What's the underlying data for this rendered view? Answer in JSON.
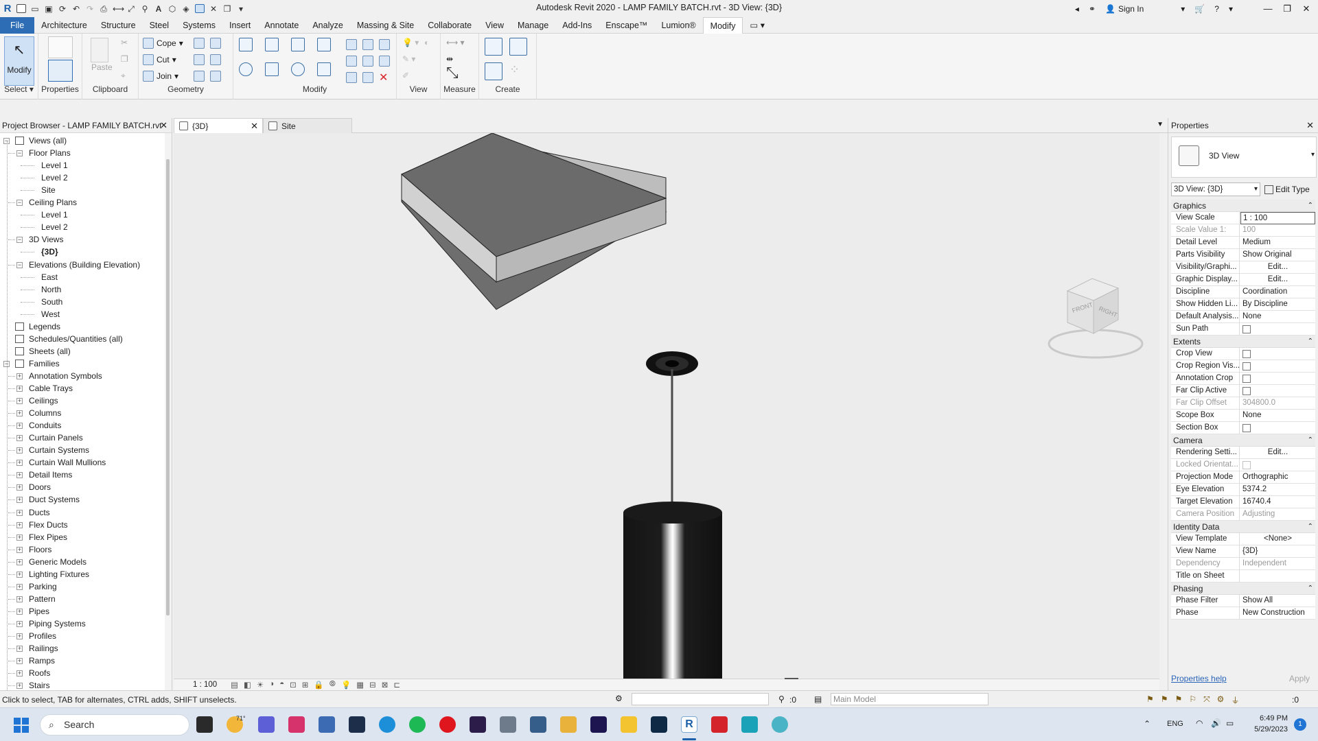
{
  "window": {
    "title": "Autodesk Revit 2020 - LAMP FAMILY BATCH.rvt - 3D View: {3D}",
    "sign_in": "Sign In"
  },
  "menu": [
    "File",
    "Architecture",
    "Structure",
    "Steel",
    "Systems",
    "Insert",
    "Annotate",
    "Analyze",
    "Massing & Site",
    "Collaborate",
    "View",
    "Manage",
    "Add-Ins",
    "Enscape™",
    "Lumion®",
    "Modify"
  ],
  "ribbon": {
    "select": {
      "modify": "Modify",
      "label": "Select"
    },
    "properties": {
      "label": "Properties",
      "btn": "Properties"
    },
    "clipboard": {
      "paste": "Paste",
      "label": "Clipboard"
    },
    "geometry": {
      "cope": "Cope",
      "cut": "Cut",
      "join": "Join",
      "label": "Geometry"
    },
    "modify": {
      "label": "Modify"
    },
    "view": {
      "label": "View"
    },
    "measure": {
      "label": "Measure"
    },
    "create": {
      "label": "Create"
    }
  },
  "browser": {
    "title": "Project Browser - LAMP FAMILY BATCH.rvt",
    "nodes": [
      {
        "text": "Views (all)",
        "level": 0,
        "exp": "-"
      },
      {
        "text": "Floor Plans",
        "level": 1,
        "exp": "-"
      },
      {
        "text": "Level 1",
        "level": 2
      },
      {
        "text": "Level 2",
        "level": 2
      },
      {
        "text": "Site",
        "level": 2
      },
      {
        "text": "Ceiling Plans",
        "level": 1,
        "exp": "-"
      },
      {
        "text": "Level 1",
        "level": 2
      },
      {
        "text": "Level 2",
        "level": 2
      },
      {
        "text": "3D Views",
        "level": 1,
        "exp": "-"
      },
      {
        "text": "{3D}",
        "level": 2,
        "bold": true
      },
      {
        "text": "Elevations (Building Elevation)",
        "level": 1,
        "exp": "-"
      },
      {
        "text": "East",
        "level": 2
      },
      {
        "text": "North",
        "level": 2
      },
      {
        "text": "South",
        "level": 2
      },
      {
        "text": "West",
        "level": 2
      },
      {
        "text": "Legends",
        "level": 0
      },
      {
        "text": "Schedules/Quantities (all)",
        "level": 0
      },
      {
        "text": "Sheets (all)",
        "level": 0
      },
      {
        "text": "Families",
        "level": 0,
        "exp": "-"
      },
      {
        "text": "Annotation Symbols",
        "level": 1,
        "exp": "+"
      },
      {
        "text": "Cable Trays",
        "level": 1,
        "exp": "+"
      },
      {
        "text": "Ceilings",
        "level": 1,
        "exp": "+"
      },
      {
        "text": "Columns",
        "level": 1,
        "exp": "+"
      },
      {
        "text": "Conduits",
        "level": 1,
        "exp": "+"
      },
      {
        "text": "Curtain Panels",
        "level": 1,
        "exp": "+"
      },
      {
        "text": "Curtain Systems",
        "level": 1,
        "exp": "+"
      },
      {
        "text": "Curtain Wall Mullions",
        "level": 1,
        "exp": "+"
      },
      {
        "text": "Detail Items",
        "level": 1,
        "exp": "+"
      },
      {
        "text": "Doors",
        "level": 1,
        "exp": "+"
      },
      {
        "text": "Duct Systems",
        "level": 1,
        "exp": "+"
      },
      {
        "text": "Ducts",
        "level": 1,
        "exp": "+"
      },
      {
        "text": "Flex Ducts",
        "level": 1,
        "exp": "+"
      },
      {
        "text": "Flex Pipes",
        "level": 1,
        "exp": "+"
      },
      {
        "text": "Floors",
        "level": 1,
        "exp": "+"
      },
      {
        "text": "Generic Models",
        "level": 1,
        "exp": "+"
      },
      {
        "text": "Lighting Fixtures",
        "level": 1,
        "exp": "+"
      },
      {
        "text": "Parking",
        "level": 1,
        "exp": "+"
      },
      {
        "text": "Pattern",
        "level": 1,
        "exp": "+"
      },
      {
        "text": "Pipes",
        "level": 1,
        "exp": "+"
      },
      {
        "text": "Piping Systems",
        "level": 1,
        "exp": "+"
      },
      {
        "text": "Profiles",
        "level": 1,
        "exp": "+"
      },
      {
        "text": "Railings",
        "level": 1,
        "exp": "+"
      },
      {
        "text": "Ramps",
        "level": 1,
        "exp": "+"
      },
      {
        "text": "Roofs",
        "level": 1,
        "exp": "+"
      },
      {
        "text": "Stairs",
        "level": 1,
        "exp": "+"
      }
    ]
  },
  "tabs": [
    {
      "label": "{3D}",
      "active": true
    },
    {
      "label": "Site",
      "active": false
    }
  ],
  "viewcube": {
    "front": "FRONT",
    "right": "RIGHT"
  },
  "view_controls": {
    "scale": "1 : 100"
  },
  "properties": {
    "title": "Properties",
    "type_name": "3D View",
    "instance_selector": "3D View: {3D}",
    "edit_type": "Edit Type",
    "groups": [
      {
        "name": "Graphics",
        "rows": [
          {
            "k": "View Scale",
            "v": "1 : 100",
            "sel": true
          },
          {
            "k": "Scale Value    1:",
            "v": "100",
            "dim": true
          },
          {
            "k": "Detail Level",
            "v": "Medium"
          },
          {
            "k": "Parts Visibility",
            "v": "Show Original"
          },
          {
            "k": "Visibility/Graphi...",
            "v": "Edit...",
            "btn": true
          },
          {
            "k": "Graphic Display...",
            "v": "Edit...",
            "btn": true
          },
          {
            "k": "Discipline",
            "v": "Coordination"
          },
          {
            "k": "Show Hidden Li...",
            "v": "By Discipline"
          },
          {
            "k": "Default Analysis...",
            "v": "None"
          },
          {
            "k": "Sun Path",
            "v": "",
            "cb": true
          }
        ]
      },
      {
        "name": "Extents",
        "rows": [
          {
            "k": "Crop View",
            "v": "",
            "cb": true
          },
          {
            "k": "Crop Region Vis...",
            "v": "",
            "cb": true
          },
          {
            "k": "Annotation Crop",
            "v": "",
            "cb": true
          },
          {
            "k": "Far Clip Active",
            "v": "",
            "cb": true
          },
          {
            "k": "Far Clip Offset",
            "v": "304800.0",
            "dim": true
          },
          {
            "k": "Scope Box",
            "v": "None"
          },
          {
            "k": "Section Box",
            "v": "",
            "cb": true
          }
        ]
      },
      {
        "name": "Camera",
        "rows": [
          {
            "k": "Rendering Setti...",
            "v": "Edit...",
            "btn": true
          },
          {
            "k": "Locked Orientat...",
            "v": "",
            "cb": true,
            "dim": true
          },
          {
            "k": "Projection Mode",
            "v": "Orthographic"
          },
          {
            "k": "Eye Elevation",
            "v": "5374.2"
          },
          {
            "k": "Target Elevation",
            "v": "16740.4"
          },
          {
            "k": "Camera Position",
            "v": "Adjusting",
            "dim": true
          }
        ]
      },
      {
        "name": "Identity Data",
        "rows": [
          {
            "k": "View Template",
            "v": "<None>",
            "btn": true
          },
          {
            "k": "View Name",
            "v": "{3D}"
          },
          {
            "k": "Dependency",
            "v": "Independent",
            "dim": true
          },
          {
            "k": "Title on Sheet",
            "v": ""
          }
        ]
      },
      {
        "name": "Phasing",
        "rows": [
          {
            "k": "Phase Filter",
            "v": "Show All"
          },
          {
            "k": "Phase",
            "v": "New Construction"
          }
        ]
      }
    ],
    "help": "Properties help",
    "apply": "Apply"
  },
  "status": {
    "hint": "Click to select, TAB for alternates, CTRL adds, SHIFT unselects.",
    "zero": ":0",
    "model": "Main Model",
    "filter_count": ":0"
  },
  "taskbar": {
    "search": "Search",
    "weather": "71°",
    "time": "6:49 PM",
    "date": "5/29/2023",
    "lang": "ENG",
    "notif": "1"
  }
}
